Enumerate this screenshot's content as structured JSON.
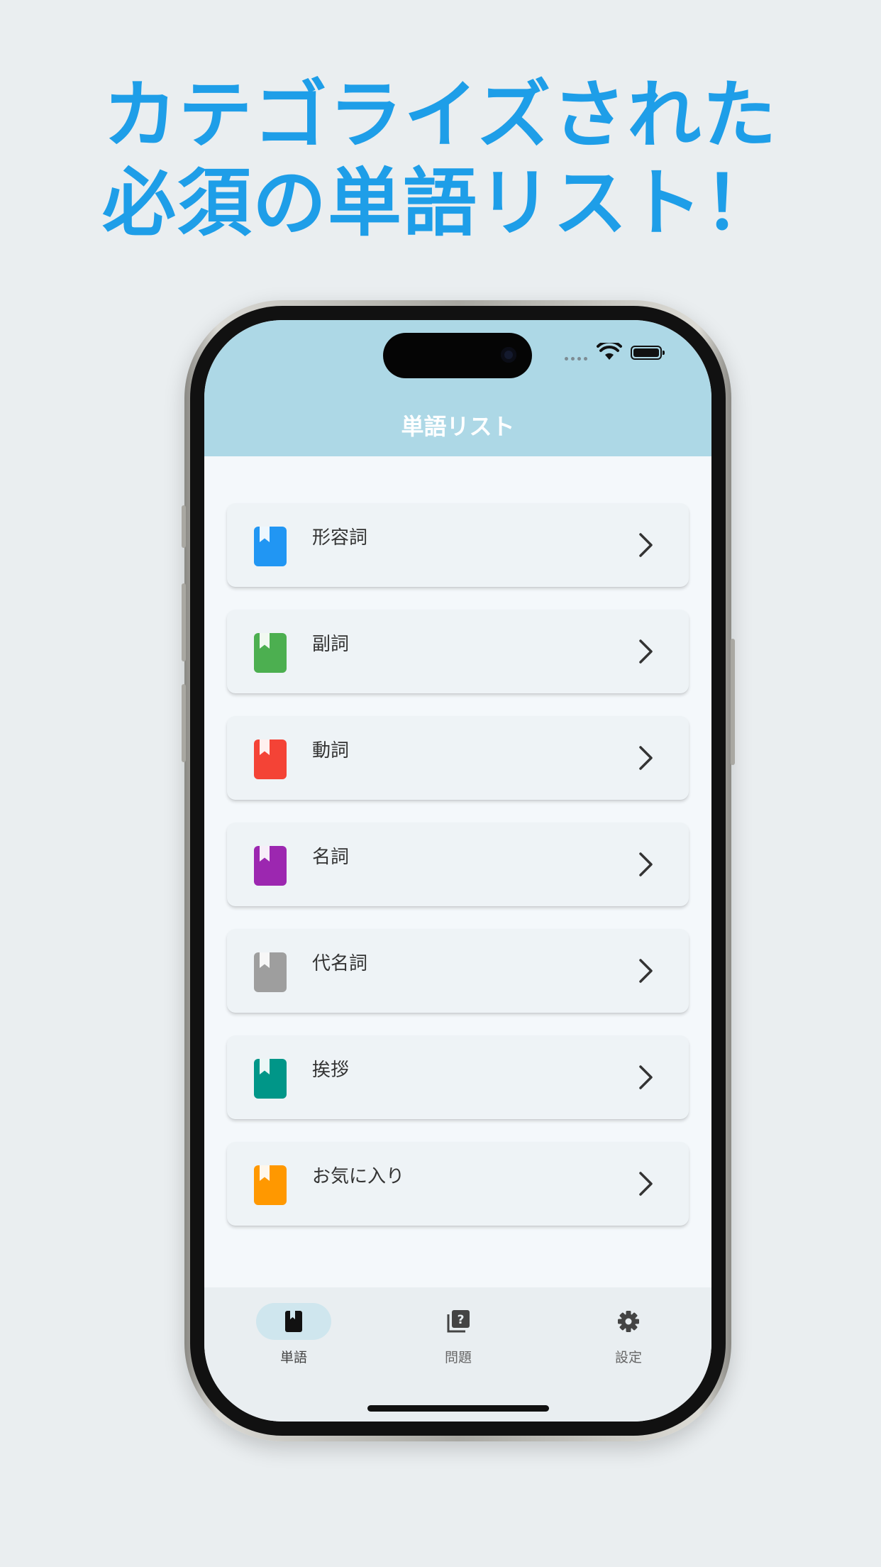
{
  "promo": {
    "line1": "カテゴライズされた",
    "line2": "必須の単語リスト！",
    "color": "#1e9ee8"
  },
  "status_bar": {
    "icons": [
      "signal-dots-icon",
      "wifi-icon",
      "battery-icon"
    ]
  },
  "header": {
    "title": "単語リスト",
    "background": "#add8e6"
  },
  "categories": [
    {
      "label": "形容詞",
      "color": "#2196f3",
      "icon": "bookmark-book-icon"
    },
    {
      "label": "副詞",
      "color": "#4caf50",
      "icon": "bookmark-book-icon"
    },
    {
      "label": "動詞",
      "color": "#f44336",
      "icon": "bookmark-book-icon"
    },
    {
      "label": "名詞",
      "color": "#9c27b0",
      "icon": "bookmark-book-icon"
    },
    {
      "label": "代名詞",
      "color": "#9e9e9e",
      "icon": "bookmark-book-icon"
    },
    {
      "label": "挨拶",
      "color": "#009688",
      "icon": "bookmark-book-icon"
    },
    {
      "label": "お気に入り",
      "color": "#ff9800",
      "icon": "bookmark-book-icon"
    }
  ],
  "bottom_nav": {
    "items": [
      {
        "label": "単語",
        "icon": "book-icon",
        "active": true
      },
      {
        "label": "問題",
        "icon": "quiz-icon",
        "active": false
      },
      {
        "label": "設定",
        "icon": "gear-icon",
        "active": false
      }
    ]
  }
}
